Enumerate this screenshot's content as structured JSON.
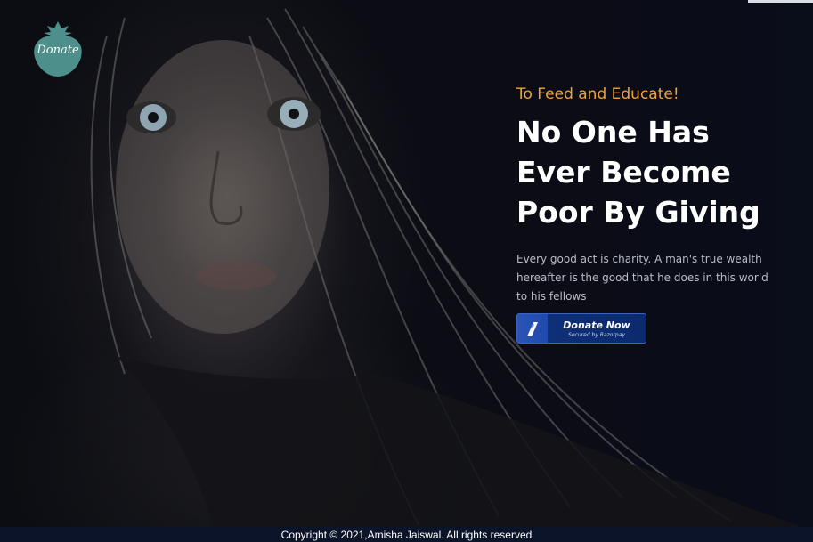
{
  "logo": {
    "label": "Donate"
  },
  "hero": {
    "tagline": "To Feed and Educate!",
    "headline": "No One Has Ever Become Poor By Giving",
    "description": "Every good act is charity. A man's true wealth hereafter is the good that he does in this world to his fellows",
    "image_subject": "portrait of a young girl"
  },
  "donate_button": {
    "label": "Donate Now",
    "sublabel": "Secured by Razorpay",
    "icon": "razorpay-icon"
  },
  "footer": {
    "copyright": "Copyright © 2021,Amisha Jaiswal. All rights reserved"
  },
  "colors": {
    "tagline": "#f0a23a",
    "logo": "#4d8f8a",
    "button": "#0b2a6e",
    "background": "#0a0f1c"
  }
}
